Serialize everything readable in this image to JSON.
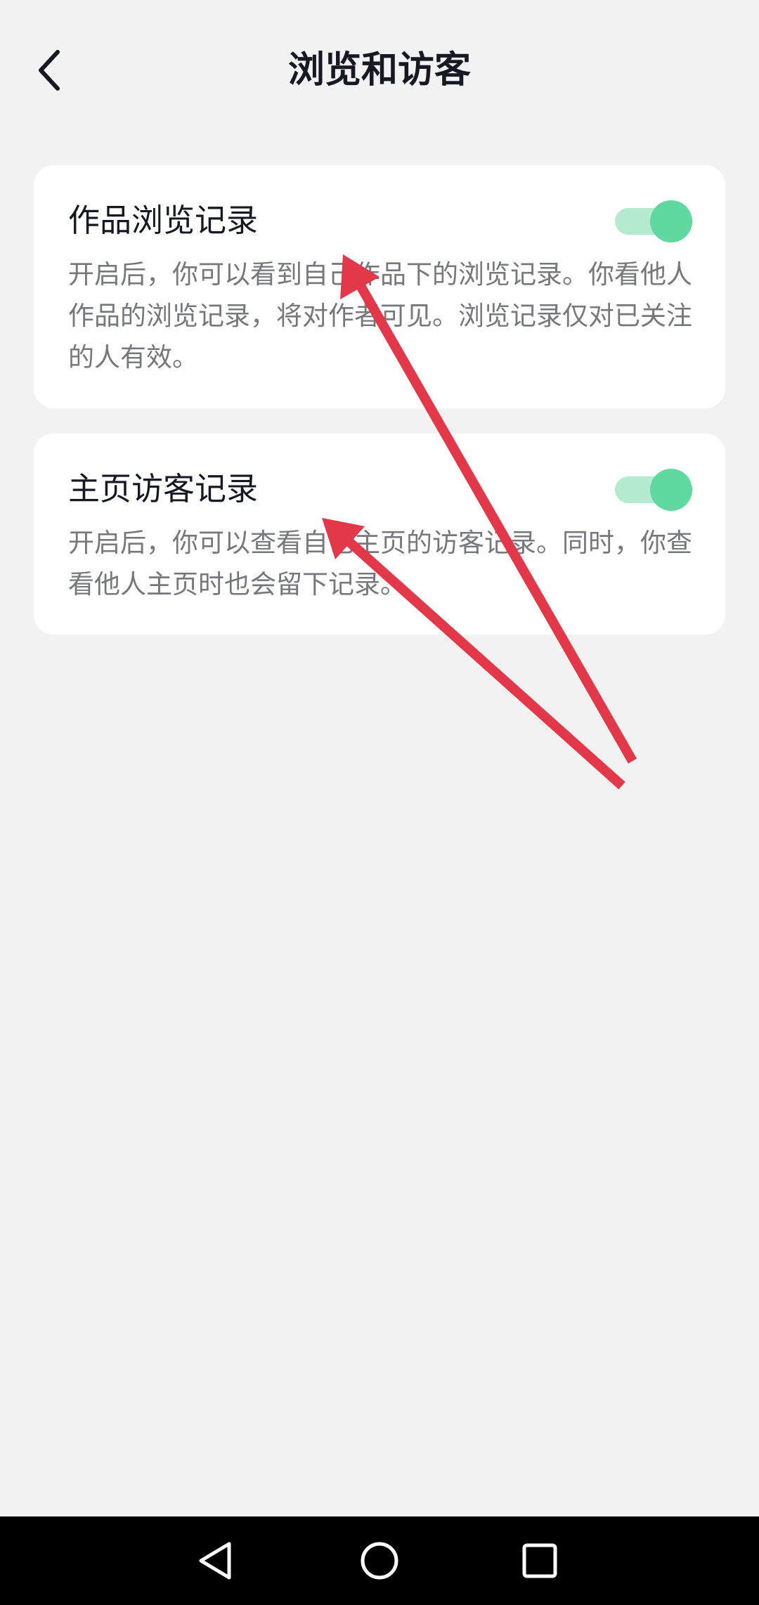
{
  "header": {
    "title": "浏览和访客",
    "back_icon": "chevron-left-icon"
  },
  "settings": [
    {
      "title": "作品浏览记录",
      "description": "开启后，你可以看到自己作品下的浏览记录。你看他人作品的浏览记录，将对作者可见。浏览记录仅对已关注的人有效。",
      "enabled": true
    },
    {
      "title": "主页访客记录",
      "description": "开启后，你可以查看自己主页的访客记录。同时，你查看他人主页时也会留下记录。",
      "enabled": true
    }
  ],
  "nav_bar": {
    "back_icon": "triangle-back-icon",
    "home_icon": "circle-home-icon",
    "recents_icon": "square-recents-icon"
  },
  "colors": {
    "background": "#f2f2f2",
    "card": "#ffffff",
    "toggle_on": "#5fd99f",
    "toggle_track_on": "#b4ead0",
    "annotation_arrow": "#e2384a"
  }
}
